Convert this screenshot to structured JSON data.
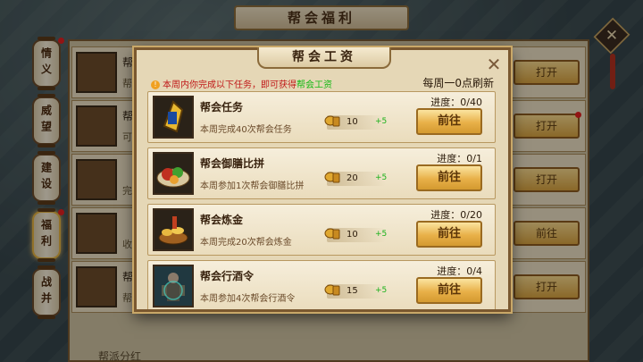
{
  "banner": {
    "title": "帮会福利"
  },
  "side_tabs": [
    {
      "label": "情义",
      "badge": true
    },
    {
      "label": "威望",
      "badge": false
    },
    {
      "label": "建设",
      "badge": false
    },
    {
      "label": "福利",
      "badge": true,
      "active": true
    },
    {
      "label": "战并",
      "badge": false
    }
  ],
  "bg_rows": [
    {
      "name": "帮会",
      "desc": "帮会",
      "button": "打开",
      "badge": false
    },
    {
      "name": "帮会",
      "desc": "可获",
      "button": "打开",
      "badge": true
    },
    {
      "name": "",
      "desc": "完成",
      "button": "打开",
      "badge": false
    },
    {
      "name": "",
      "desc": "收集",
      "button": "前往",
      "badge": false
    },
    {
      "name": "帮会",
      "desc": "帮主",
      "button": "打开",
      "badge": false
    }
  ],
  "bg_bottom_label": "帮派分红",
  "dialog": {
    "title": "帮会工资",
    "close": "✕",
    "notice_prefix": "本周内你完成以下任务，即可获得",
    "notice_highlight": "帮会工资",
    "refresh": "每周一0点刷新",
    "tasks": [
      {
        "name": "帮会任务",
        "desc": "本周完成40次帮会任务",
        "reward": "10",
        "plus": "+5",
        "progress": "进度：0/40",
        "button": "前往",
        "icon": "token-icon"
      },
      {
        "name": "帮会御膳比拼",
        "desc": "本周参加1次帮会御膳比拼",
        "reward": "20",
        "plus": "+5",
        "progress": "进度：0/1",
        "button": "前往",
        "icon": "feast-icon"
      },
      {
        "name": "帮会炼金",
        "desc": "本周完成20次帮会炼金",
        "reward": "10",
        "plus": "+5",
        "progress": "进度：0/20",
        "button": "前往",
        "icon": "alchemy-icon"
      },
      {
        "name": "帮会行酒令",
        "desc": "本周参加4次帮会行酒令",
        "reward": "15",
        "plus": "+5",
        "progress": "进度：0/4",
        "button": "前往",
        "icon": "drinking-icon"
      }
    ]
  },
  "colors": {
    "accent": "#e8b048",
    "notice_red": "#c01818",
    "notice_green": "#14b814",
    "badge": "#e02020"
  }
}
